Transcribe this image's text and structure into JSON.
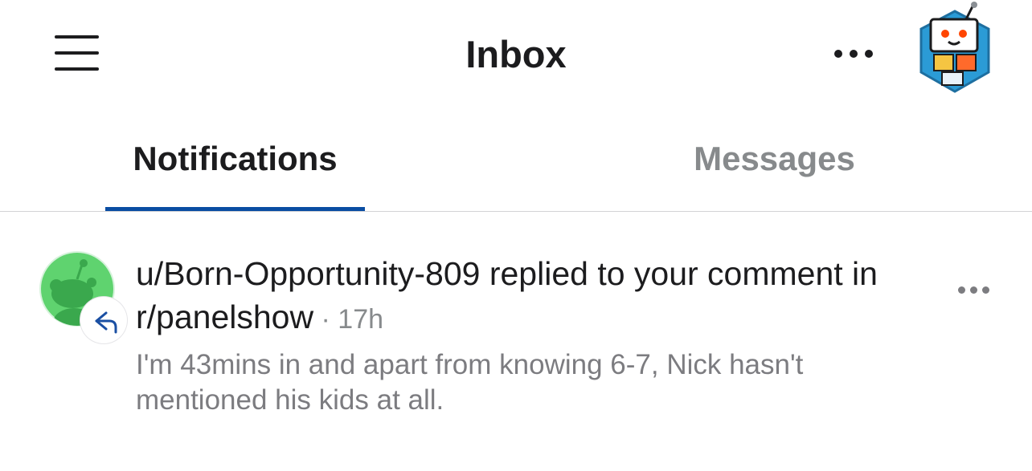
{
  "header": {
    "title": "Inbox",
    "menu_icon": "hamburger-menu-icon",
    "more_icon": "more-horizontal-icon",
    "avatar_icon": "user-avatar-icon"
  },
  "tabs": [
    {
      "label": "Notifications",
      "active": true
    },
    {
      "label": "Messages",
      "active": false
    }
  ],
  "colors": {
    "accent": "#0a4da2",
    "inactive_tab": "#878a8c",
    "avatar_green": "#46d160"
  },
  "notifications": [
    {
      "title": "u/Born-Opportunity-809 replied to your comment in r/panelshow",
      "separator": " · ",
      "time": "17h",
      "body": "I'm 43mins in and apart from knowing 6-7, Nick hasn't mentioned his kids at all.",
      "badge_icon": "reply-arrow-icon",
      "avatar_icon": "snoo-avatar-icon",
      "more_icon": "more-horizontal-icon"
    }
  ]
}
